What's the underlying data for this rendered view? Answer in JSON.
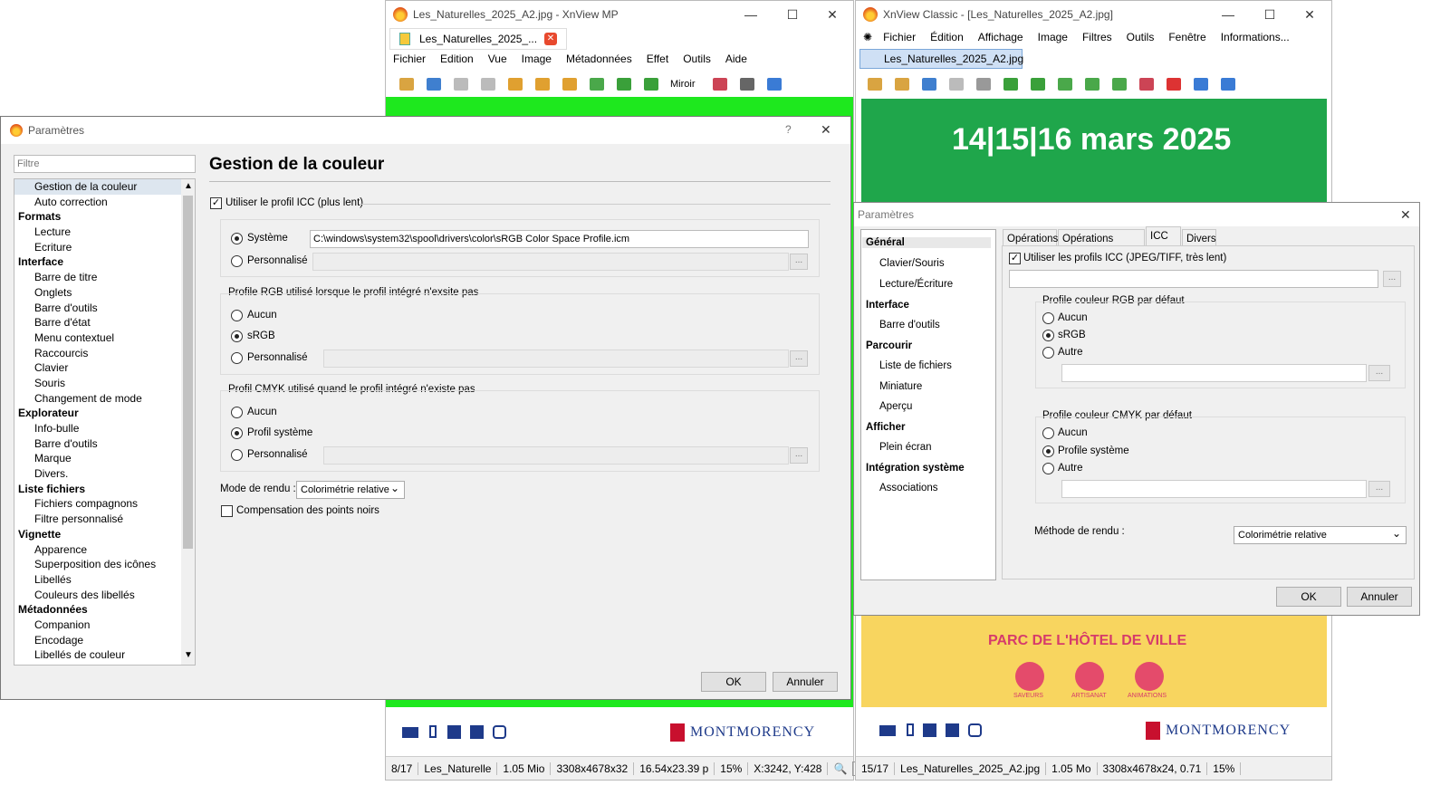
{
  "mp": {
    "title": "Les_Naturelles_2025_A2.jpg - XnView MP",
    "tab": "Les_Naturelles_2025_...",
    "menu": [
      "Fichier",
      "Edition",
      "Vue",
      "Image",
      "Métadonnées",
      "Effet",
      "Outils",
      "Aide"
    ],
    "toolbar_text": "Miroir",
    "status": [
      "8/17",
      "Les_Naturelle",
      "1.05 Mio",
      "3308x4678x32",
      "16.54x23.39 p",
      "15%",
      "X:3242, Y:428"
    ]
  },
  "classic": {
    "title": "XnView Classic - [Les_Naturelles_2025_A2.jpg]",
    "menu": [
      "Fichier",
      "Édition",
      "Affichage",
      "Image",
      "Filtres",
      "Outils",
      "Fenêtre",
      "Informations..."
    ],
    "tab": "Les_Naturelles_2025_A2.jpg",
    "poster_heading": "14|15|16 mars 2025",
    "poster_place": "PARC DE L'HÔTEL DE VILLE",
    "poster_icons": [
      "SAVEURS",
      "ARTISANAT",
      "ANIMATIONS"
    ],
    "logo": "MONTMORENCY",
    "status": [
      "15/17",
      "Les_Naturelles_2025_A2.jpg",
      "1.05 Mo",
      "3308x4678x24, 0.71",
      "15%"
    ]
  },
  "mp_dialog": {
    "title": "Parametres",
    "title_text": "Paramètres",
    "help": "?",
    "filter_placeholder": "Filtre",
    "heading": "Gestion de la couleur",
    "use_icc": "Utiliser le profil ICC (plus lent)",
    "system_label": "Système",
    "system_path": "C:\\windows\\system32\\spool\\drivers\\color\\sRGB Color Space Profile.icm",
    "custom_label": "Personnalisé",
    "rgb_group": "Profile RGB utilisé lorsque le profil intégré n'exsite pas",
    "rgb_options": [
      "Aucun",
      "sRGB",
      "Personnalisé"
    ],
    "cmyk_group": "Profil CMYK utilisé quand le profil intégré n'existe pas",
    "cmyk_options": [
      "Aucun",
      "Profil système",
      "Personnalisé"
    ],
    "render_label": "Mode de rendu :",
    "render_value": "Colorimétrie relative",
    "black_points": "Compensation des points noirs",
    "ok": "OK",
    "cancel": "Annuler",
    "tree": [
      {
        "t": "Gestion de la couleur",
        "k": "c",
        "sel": true
      },
      {
        "t": "Auto correction",
        "k": "c"
      },
      {
        "t": "Formats",
        "k": "h"
      },
      {
        "t": "Lecture",
        "k": "c"
      },
      {
        "t": "Ecriture",
        "k": "c"
      },
      {
        "t": "Interface",
        "k": "h"
      },
      {
        "t": "Barre de titre",
        "k": "c"
      },
      {
        "t": "Onglets",
        "k": "c"
      },
      {
        "t": "Barre d'outils",
        "k": "c"
      },
      {
        "t": "Barre d'état",
        "k": "c"
      },
      {
        "t": "Menu contextuel",
        "k": "c"
      },
      {
        "t": "Raccourcis",
        "k": "c"
      },
      {
        "t": "Clavier",
        "k": "c"
      },
      {
        "t": "Souris",
        "k": "c"
      },
      {
        "t": "Changement de mode",
        "k": "c"
      },
      {
        "t": "Explorateur",
        "k": "h"
      },
      {
        "t": "Info-bulle",
        "k": "c"
      },
      {
        "t": "Barre d'outils",
        "k": "c"
      },
      {
        "t": "Marque",
        "k": "c"
      },
      {
        "t": "Divers.",
        "k": "c"
      },
      {
        "t": "Liste fichiers",
        "k": "h"
      },
      {
        "t": "Fichiers compagnons",
        "k": "c"
      },
      {
        "t": "Filtre personnalisé",
        "k": "c"
      },
      {
        "t": "Vignette",
        "k": "h"
      },
      {
        "t": "Apparence",
        "k": "c"
      },
      {
        "t": "Superposition des icônes",
        "k": "c"
      },
      {
        "t": "Libellés",
        "k": "c"
      },
      {
        "t": "Couleurs des libellés",
        "k": "c"
      },
      {
        "t": "Métadonnées",
        "k": "h"
      },
      {
        "t": "Companion",
        "k": "c"
      },
      {
        "t": "Encodage",
        "k": "c"
      },
      {
        "t": "Libellés de couleur",
        "k": "c"
      }
    ]
  },
  "classic_dialog": {
    "title": "Paramètres",
    "tree": [
      {
        "t": "Général",
        "k": "h",
        "sel": true
      },
      {
        "t": "Clavier/Souris",
        "k": "c"
      },
      {
        "t": "Lecture/Écriture",
        "k": "c"
      },
      {
        "t": "Interface",
        "k": "h"
      },
      {
        "t": "Barre d'outils",
        "k": "c"
      },
      {
        "t": "Parcourir",
        "k": "h"
      },
      {
        "t": "Liste de fichiers",
        "k": "c"
      },
      {
        "t": "Miniature",
        "k": "c"
      },
      {
        "t": "Aperçu",
        "k": "c"
      },
      {
        "t": "Afficher",
        "k": "h"
      },
      {
        "t": "Plein écran",
        "k": "c"
      },
      {
        "t": "Intégration système",
        "k": "h"
      },
      {
        "t": "Associations",
        "k": "c"
      }
    ],
    "tabs": [
      "Opérations",
      "Opérations fichiers",
      "ICC",
      "Divers"
    ],
    "use_icc": "Utiliser les profils ICC (JPEG/TIFF, très lent)",
    "rgb_group": "Profile couleur RGB par défaut",
    "rgb_options": [
      "Aucun",
      "sRGB",
      "Autre"
    ],
    "cmyk_group": "Profile couleur CMYK par défaut",
    "cmyk_options": [
      "Aucun",
      "Profile système",
      "Autre"
    ],
    "render_label": "Méthode de rendu :",
    "render_value": "Colorimétrie relative",
    "ok": "OK",
    "cancel": "Annuler"
  },
  "colors": {
    "green": "#2db556",
    "poster_green": "#1fa64b",
    "yellow": "#f8d55f",
    "mp_bg": "#1ee81e"
  }
}
